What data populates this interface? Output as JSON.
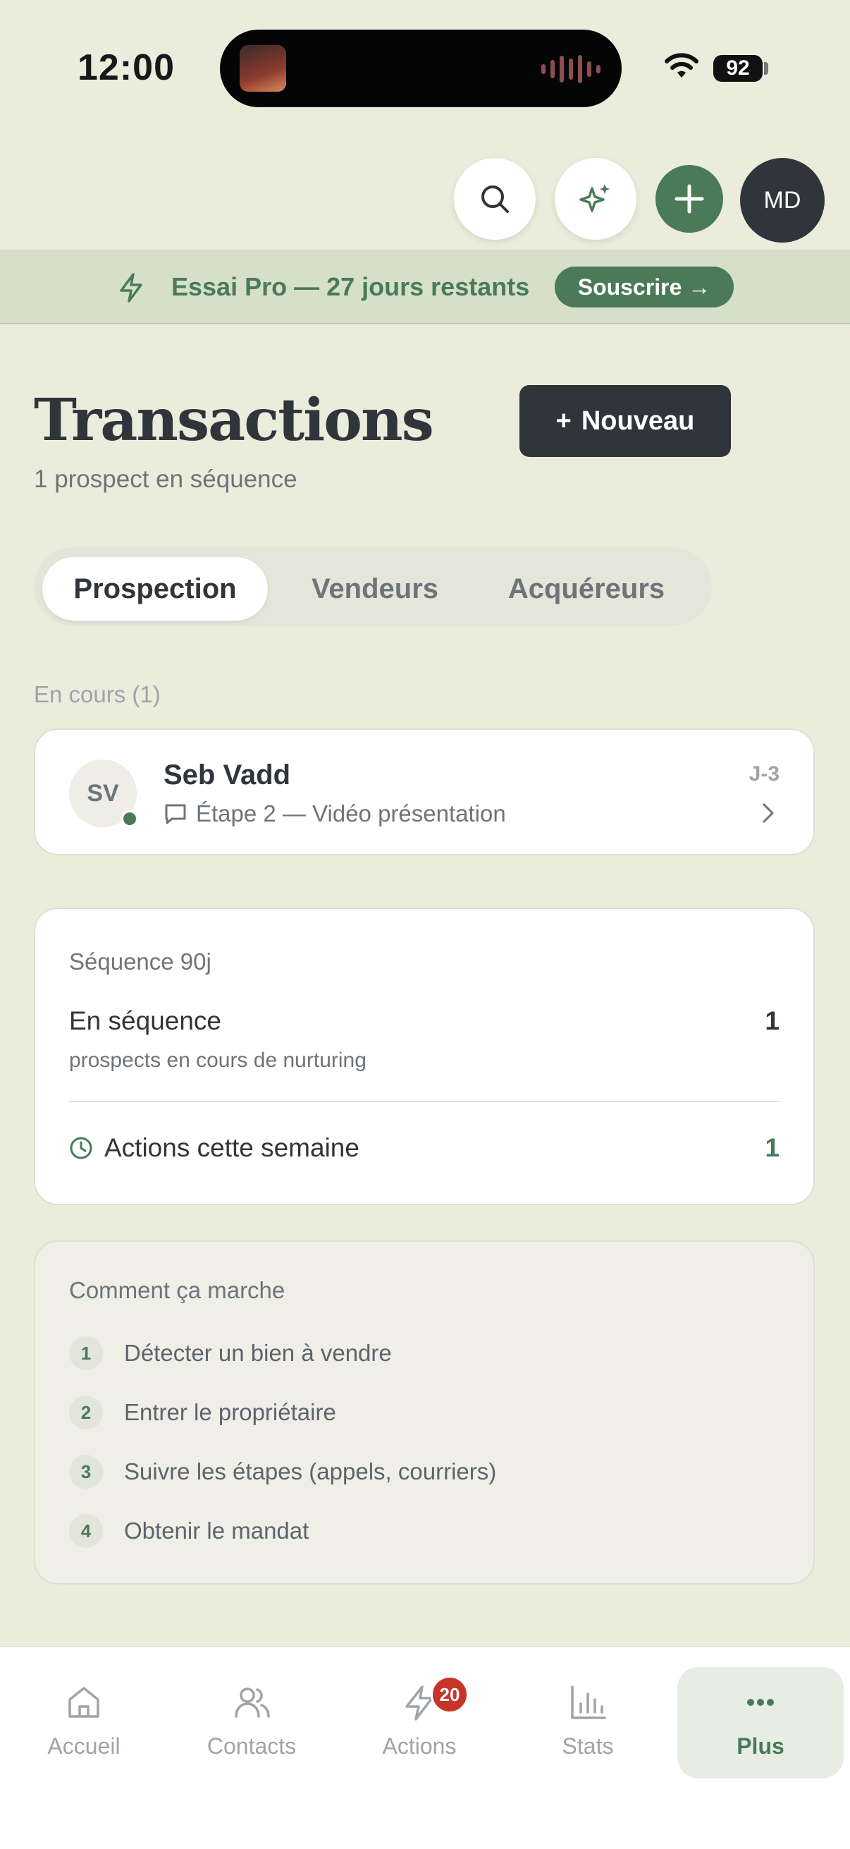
{
  "status_bar": {
    "time": "12:00",
    "battery": "92"
  },
  "header_actions": {
    "avatar_initials": "MD"
  },
  "trial_banner": {
    "text": "Essai Pro — 27 jours restants",
    "button_label": "Souscrire →"
  },
  "page": {
    "title": "Transactions",
    "subtitle": "1 prospect en séquence",
    "new_button_plus": "+",
    "new_button_label": "Nouveau"
  },
  "tabs": [
    {
      "label": "Prospection",
      "active": true
    },
    {
      "label": "Vendeurs",
      "active": false
    },
    {
      "label": "Acquéreurs",
      "active": false
    }
  ],
  "in_progress": {
    "section_label": "En cours (1)",
    "prospect": {
      "initials": "SV",
      "name": "Seb Vadd",
      "step": "Étape 2 — Vidéo présentation",
      "due": "J-3"
    }
  },
  "sequence_card": {
    "heading": "Séquence 90j",
    "in_sequence_label": "En séquence",
    "in_sequence_value": "1",
    "in_sequence_desc": "prospects en cours de nurturing",
    "week_actions_label": "Actions cette semaine",
    "week_actions_value": "1"
  },
  "how_it_works": {
    "heading": "Comment ça marche",
    "steps": [
      {
        "num": "1",
        "text": "Détecter un bien à vendre"
      },
      {
        "num": "2",
        "text": "Entrer le propriétaire"
      },
      {
        "num": "3",
        "text": "Suivre les étapes (appels, courriers)"
      },
      {
        "num": "4",
        "text": "Obtenir le mandat"
      }
    ]
  },
  "bottom_nav": {
    "items": [
      {
        "label": "Accueil",
        "icon": "home-icon"
      },
      {
        "label": "Contacts",
        "icon": "users-icon"
      },
      {
        "label": "Actions",
        "icon": "bolt-icon",
        "badge": "20"
      },
      {
        "label": "Stats",
        "icon": "bar-chart-icon"
      },
      {
        "label": "Plus",
        "icon": "more-icon",
        "active": true
      }
    ]
  },
  "colors": {
    "background": "#ebeddc",
    "accent_green": "#4a7a58",
    "dark": "#2f353b",
    "badge_red": "#c8332a",
    "banner": "#d6dfc8"
  }
}
